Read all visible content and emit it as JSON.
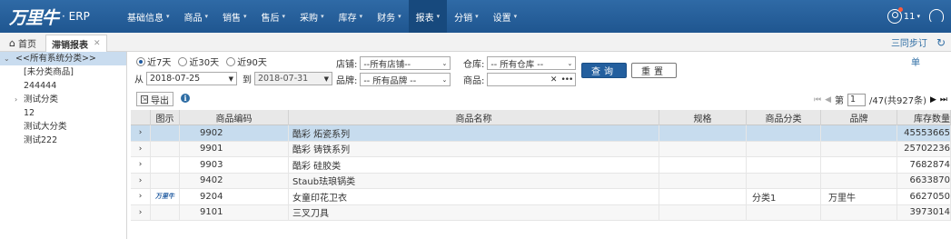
{
  "app": {
    "logo_mark": "万里牛",
    "logo_text": "· ERP",
    "menu": [
      {
        "label": "基础信息",
        "active": false
      },
      {
        "label": "商品",
        "active": false
      },
      {
        "label": "销售",
        "active": false
      },
      {
        "label": "售后",
        "active": false
      },
      {
        "label": "采购",
        "active": false
      },
      {
        "label": "库存",
        "active": false
      },
      {
        "label": "财务",
        "active": false
      },
      {
        "label": "报表",
        "active": true
      },
      {
        "label": "分销",
        "active": false
      },
      {
        "label": "设置",
        "active": false
      }
    ],
    "user_badge": "11",
    "accent_color": "#235f9e"
  },
  "tabs": {
    "home_label": "首页",
    "active_label": "滞销报表",
    "sync_label": "三同步订"
  },
  "sidebar": {
    "root_label": "<<所有系统分类>>",
    "items": [
      {
        "label": "[未分类商品]",
        "expandable": false
      },
      {
        "label": "244444",
        "expandable": false
      },
      {
        "label": "测试分类",
        "expandable": true
      },
      {
        "label": "12",
        "expandable": false
      },
      {
        "label": "测试大分类",
        "expandable": false
      },
      {
        "label": "测试222",
        "expandable": false
      }
    ]
  },
  "filters": {
    "ranges": [
      {
        "label": "近7天",
        "checked": true
      },
      {
        "label": "近30天",
        "checked": false
      },
      {
        "label": "近90天",
        "checked": false
      }
    ],
    "from_label": "从",
    "date_from": "2018-07-25",
    "to_label": "到",
    "date_to": "2018-07-31",
    "shop_label": "店铺:",
    "shop_value": "--所有店铺--",
    "brand_label": "品牌:",
    "brand_value": "-- 所有品牌 --",
    "warehouse_label": "仓库:",
    "warehouse_value": "-- 所有仓库 --",
    "product_label": "商品:",
    "product_value": "",
    "query_button": "查询",
    "reset_button": "重置",
    "corner_text": "单"
  },
  "toolbar": {
    "export_label": "导出"
  },
  "pager": {
    "page_label": "第",
    "current_page": "1",
    "total_text": "/47(共927条)"
  },
  "grid": {
    "headers": {
      "image": "图示",
      "code": "商品编码",
      "name": "商品名称",
      "spec": "规格",
      "category": "商品分类",
      "brand": "品牌",
      "stock": "库存数量"
    },
    "rows": [
      {
        "code": "9902",
        "name": "酷彩 炻瓷系列",
        "spec": "",
        "category": "",
        "brand": "",
        "stock": "45553665",
        "thumb": "",
        "selected": true
      },
      {
        "code": "9901",
        "name": "酷彩 铸铁系列",
        "spec": "",
        "category": "",
        "brand": "",
        "stock": "25702236",
        "thumb": "",
        "selected": false
      },
      {
        "code": "9903",
        "name": "酷彩 硅胶类",
        "spec": "",
        "category": "",
        "brand": "",
        "stock": "7682874",
        "thumb": "",
        "selected": false
      },
      {
        "code": "9402",
        "name": "Staub珐琅锅类",
        "spec": "",
        "category": "",
        "brand": "",
        "stock": "6633870",
        "thumb": "",
        "selected": false
      },
      {
        "code": "9204",
        "name": "女童印花卫衣",
        "spec": "",
        "category": "分类1",
        "brand": "万里牛",
        "stock": "6627050",
        "thumb": "万里牛",
        "selected": false
      },
      {
        "code": "9101",
        "name": "三叉刀具",
        "spec": "",
        "category": "",
        "brand": "",
        "stock": "3973014",
        "thumb": "",
        "selected": false
      }
    ]
  }
}
